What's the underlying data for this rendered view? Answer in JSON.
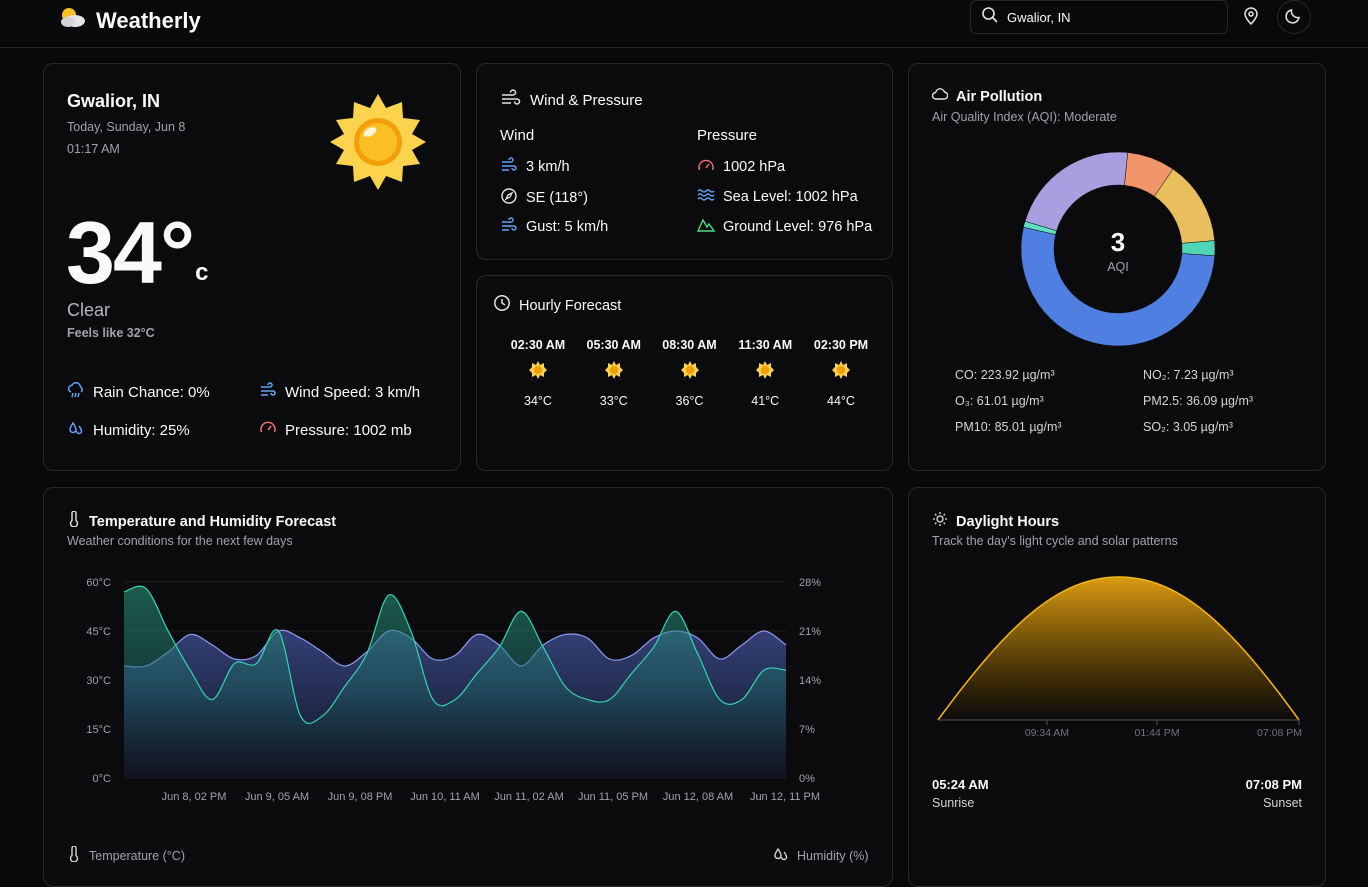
{
  "app": {
    "name": "Weatherly"
  },
  "search": {
    "value": "Gwalior, IN"
  },
  "current": {
    "location": "Gwalior, IN",
    "date": "Today, Sunday, Jun 8",
    "time": "01:17 AM",
    "temp": "34°",
    "unit": "c",
    "condition": "Clear",
    "feels_like": "Feels like 32°C",
    "rain": "Rain Chance: 0%",
    "wind": "Wind Speed: 3 km/h",
    "humidity": "Humidity: 25%",
    "pressure": "Pressure: 1002 mb"
  },
  "wind_pressure": {
    "title": "Wind & Pressure",
    "wind_heading": "Wind",
    "pressure_heading": "Pressure",
    "speed": "3 km/h",
    "direction": "SE (118°)",
    "gust": "Gust: 5 km/h",
    "pressure": "1002 hPa",
    "sea_level": "Sea Level: 1002 hPa",
    "ground_level": "Ground Level: 976 hPa"
  },
  "hourly": {
    "title": "Hourly Forecast",
    "items": [
      {
        "time": "02:30 AM",
        "temp": "34°C"
      },
      {
        "time": "05:30 AM",
        "temp": "33°C"
      },
      {
        "time": "08:30 AM",
        "temp": "36°C"
      },
      {
        "time": "11:30 AM",
        "temp": "41°C"
      },
      {
        "time": "02:30 PM",
        "temp": "44°C"
      }
    ]
  },
  "air": {
    "title": "Air Pollution",
    "subtitle": "Air Quality Index (AQI): Moderate",
    "aqi": "3",
    "aqi_label": "AQI",
    "pollutants": [
      "CO: 223.92 µg/m³",
      "NO₂: 7.23 µg/m³",
      "O₃: 61.01 µg/m³",
      "PM2.5: 36.09 µg/m³",
      "PM10: 85.01 µg/m³",
      "SO₂: 3.05 µg/m³"
    ]
  },
  "forecast": {
    "title": "Temperature and Humidity Forecast",
    "subtitle": "Weather conditions for the next few days",
    "legend_temp": "Temperature (°C)",
    "legend_humidity": "Humidity (%)"
  },
  "daylight": {
    "title": "Daylight Hours",
    "subtitle": "Track the day's light cycle and solar patterns",
    "ticks": [
      "09:34 AM",
      "01:44 PM",
      "07:08 PM"
    ],
    "sunrise_time": "05:24 AM",
    "sunrise_label": "Sunrise",
    "sunset_time": "07:08 PM",
    "sunset_label": "Sunset"
  },
  "colors": {
    "accent_blue": "#60a5fa",
    "temp_area": "#2dd4bf",
    "humidity_area": "#6366f1",
    "sun": "#f59e0b"
  },
  "chart_data": [
    {
      "type": "pie",
      "title": "",
      "categories": [
        "blue",
        "teal-small",
        "purple",
        "orange",
        "yellow",
        "teal"
      ],
      "values": [
        52.5,
        1,
        22,
        8,
        14,
        2.5
      ],
      "colors": [
        "#4f7fe0",
        "#5ee0c0",
        "#a89ee0",
        "#f0956a",
        "#e8bf5c",
        "#4fd6b6"
      ]
    },
    {
      "type": "area",
      "title": "Temperature and Humidity Forecast",
      "x_ticks": [
        "Jun 8, 02 PM",
        "Jun 9, 05 AM",
        "Jun 9, 08 PM",
        "Jun 10, 11 AM",
        "Jun 11, 02 AM",
        "Jun 11, 05 PM",
        "Jun 12, 08 AM",
        "Jun 12, 11 PM"
      ],
      "y_left_ticks": [
        "60°C",
        "45°C",
        "30°C",
        "15°C",
        "0°C"
      ],
      "y_right_ticks": [
        "28%",
        "21%",
        "14%",
        "7%",
        "0%"
      ],
      "ylim_left": [
        0,
        60
      ],
      "ylim_right": [
        0,
        28
      ],
      "series": [
        {
          "name": "Temperature (°C)",
          "axis": "left",
          "values": [
            57,
            58,
            45,
            33,
            24,
            35,
            35,
            45,
            19,
            19,
            28,
            38,
            56,
            45,
            24,
            24,
            32,
            40,
            51,
            40,
            28,
            24,
            24,
            32,
            40,
            51,
            38,
            24,
            24,
            33,
            33
          ]
        },
        {
          "name": "Humidity (%)",
          "axis": "right",
          "values": [
            16,
            16,
            18,
            20.5,
            19,
            17,
            17.5,
            21,
            20,
            18,
            16,
            18,
            21,
            20,
            17,
            17.5,
            20.5,
            19,
            16,
            19,
            20.5,
            20,
            17,
            17.5,
            20,
            21,
            20,
            17,
            19,
            21,
            19
          ]
        }
      ]
    },
    {
      "type": "area",
      "title": "Daylight Hours",
      "x": [
        "05:24 AM",
        "09:34 AM",
        "01:44 PM",
        "07:08 PM"
      ],
      "shape": "sun-arc"
    }
  ]
}
